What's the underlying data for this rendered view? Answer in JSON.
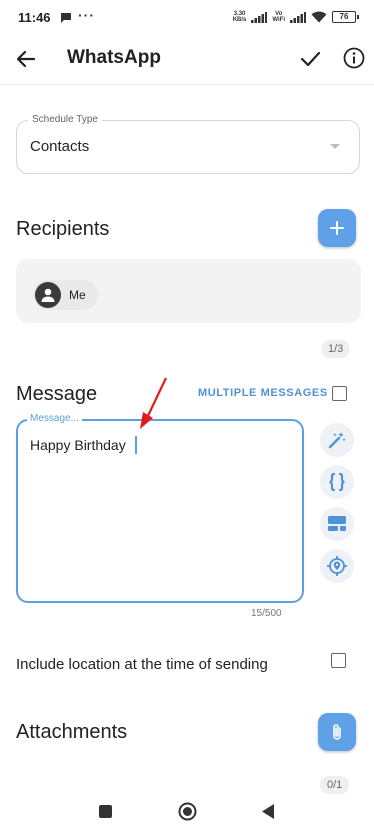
{
  "status_bar": {
    "time": "11:46",
    "dots": "···",
    "net_speed_top": "3.30",
    "net_speed_bottom": "KB/s",
    "vowifi_top": "Vo",
    "vowifi_bottom": "WiFi",
    "battery": "76"
  },
  "app_bar": {
    "title": "WhatsApp",
    "back_icon": "arrow-left-icon",
    "confirm_icon": "check-icon",
    "info_icon": "info-icon"
  },
  "schedule_type": {
    "label": "Schedule Type",
    "value": "Contacts"
  },
  "recipients": {
    "heading": "Recipients",
    "add_icon": "plus-icon",
    "chips": [
      {
        "label": "Me",
        "icon": "person-icon"
      }
    ],
    "count": "1/3"
  },
  "message": {
    "heading": "Message",
    "multiple_label": "MULTIPLE MESSAGES",
    "multiple_checked": false,
    "field_label": "Message...",
    "value": "Happy Birthday",
    "counter": "15/500",
    "tools": [
      "magic-wand-icon",
      "curly-braces-icon",
      "template-icon",
      "location-target-icon"
    ]
  },
  "location_option": {
    "label": "Include location at the time of sending",
    "checked": false
  },
  "attachments": {
    "heading": "Attachments",
    "attach_icon": "paperclip-icon",
    "count": "0/1"
  },
  "nav_bar": {
    "items": [
      "recents-square-icon",
      "home-circle-icon",
      "back-triangle-icon"
    ]
  },
  "colors": {
    "accent": "#5d9fdf",
    "fab": "#5ea1e6",
    "annotation_arrow": "#e21a1a"
  }
}
